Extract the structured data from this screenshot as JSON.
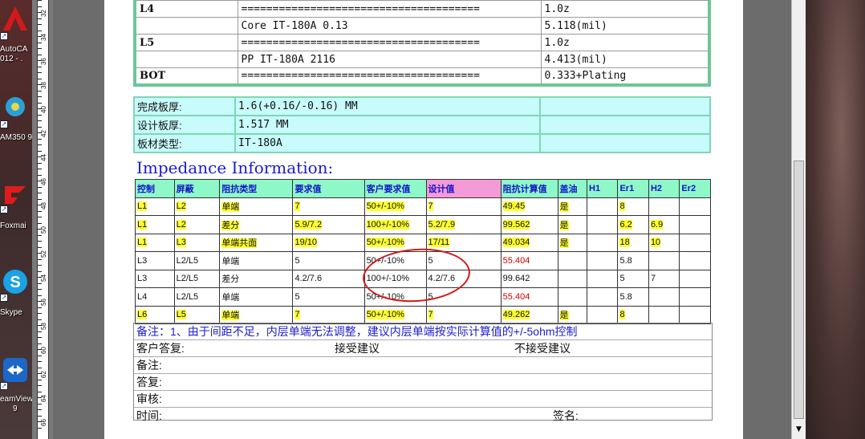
{
  "desktop": {
    "icons": [
      {
        "name": "autocad",
        "label_line1": "AutoCA",
        "label_line2": "012 - .",
        "color": "#d21a1a"
      },
      {
        "name": "am350",
        "label_line1": "AM350 9",
        "color": "#2aa0d8"
      },
      {
        "name": "foxmail",
        "label_line1": "Foxmai",
        "color": "#e01b1b"
      },
      {
        "name": "skype",
        "label_line1": "Skype",
        "color": "#1ba1e6"
      },
      {
        "name": "teamviewer",
        "label_line1": "eamView",
        "label_line2": "9",
        "color": "#1d67c9"
      }
    ]
  },
  "ruler": {
    "numbers": [
      "32",
      "34",
      "36",
      "38",
      "40",
      "42",
      "44",
      "46",
      "48",
      "50",
      "52",
      "54",
      "56",
      "58",
      "60",
      "62",
      "64",
      "66"
    ]
  },
  "stackup": {
    "rows": [
      {
        "layer": "L4",
        "material": "======================================",
        "thickness": "1.0z"
      },
      {
        "layer": "",
        "material": "Core     IT-180A    0.13",
        "thickness": "5.118(mil)"
      },
      {
        "layer": "L5",
        "material": "======================================",
        "thickness": "1.0z"
      },
      {
        "layer": "",
        "material": "PP     IT-180A    2116",
        "thickness": "4.413(mil)"
      },
      {
        "layer": "BOT",
        "material": "======================================",
        "thickness": "0.333+Plating"
      }
    ]
  },
  "board": {
    "rows": [
      {
        "key": "完成板厚:",
        "value": "1.6(+0.16/-0.16) MM"
      },
      {
        "key": "设计板厚:",
        "value": "1.517 MM"
      },
      {
        "key": "板材类型:",
        "value": "IT-180A"
      }
    ]
  },
  "impedance": {
    "title": "Impedance Information:",
    "headers": [
      "控制",
      "屏蔽",
      "阻抗类型",
      "要求值",
      "客户要求值",
      "设计值",
      "阻抗计算值",
      "盖油",
      "H1",
      "Er1",
      "H2",
      "Er2"
    ],
    "rows": [
      [
        "L1",
        "L2",
        "单端",
        "7",
        "50+/-10%",
        "7",
        "49.45",
        "是",
        "",
        "8",
        "",
        ""
      ],
      [
        "L1",
        "L2",
        "差分",
        "5.9/7.2",
        "100+/-10%",
        "5.2/7.9",
        "99.562",
        "是",
        "",
        "6.2",
        "6.9",
        ""
      ],
      [
        "L1",
        "L3",
        "单端共面",
        "19/10",
        "50+/-10%",
        "17/11",
        "49.034",
        "是",
        "",
        "18",
        "10",
        ""
      ],
      [
        "L3",
        "L2/L5",
        "单端",
        "5",
        "50+/-10%",
        "5",
        "55.404",
        "",
        "",
        "5.8",
        "",
        ""
      ],
      [
        "L3",
        "L2/L5",
        "差分",
        "4.2/7.6",
        "100+/-10%",
        "4.2/7.6",
        "99.642",
        "",
        "",
        "5",
        "7",
        ""
      ],
      [
        "L4",
        "L2/L5",
        "单端",
        "5",
        "50+/-10%",
        "5",
        "55.404",
        "",
        "",
        "5.8",
        "",
        ""
      ],
      [
        "L6",
        "L5",
        "单端",
        "7",
        "50+/-10%",
        "7",
        "49.262",
        "是",
        "",
        "8",
        "",
        ""
      ]
    ]
  },
  "remarks": {
    "note": "备注：1、由于间距不足，内层单端无法调整，建议内层单端按实际计算值的+/-5ohm控制",
    "customer_reply": "客户答复:",
    "accept": "接受建议",
    "reject": "不接受建议",
    "remark": "备注:",
    "reply": "答复:",
    "review": "审核:",
    "time": "时间:",
    "sign": "签名:"
  },
  "colors": {
    "accent_blue": "#1c1ccd",
    "header_green": "#8ef8c8",
    "header_pink": "#f49ad6",
    "highlight": "#ffff33",
    "warning_red": "#c00000"
  }
}
